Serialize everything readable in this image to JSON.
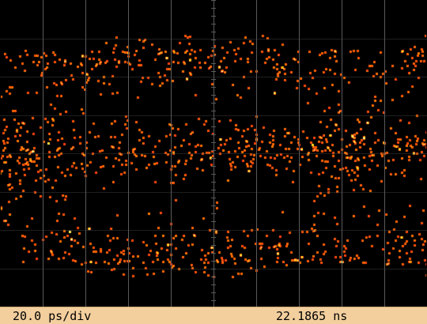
{
  "status_bar": {
    "timebase": "20.0 ps/div",
    "horizontal_position": "22.1865 ns"
  },
  "display": {
    "mode": "color-graded persistence eye diagram",
    "graticule": {
      "columns": 10,
      "rows": 8,
      "color": "#5a5a5a"
    },
    "palette": [
      "#2a1cff",
      "#5a22e8",
      "#c21a8a",
      "#e82060",
      "#ff3a12",
      "#ff7a00",
      "#ffae00",
      "#ffd400",
      "#fff24a",
      "#ffffd8"
    ],
    "outlier_color": "#2ec63a",
    "background": "#000000"
  }
}
